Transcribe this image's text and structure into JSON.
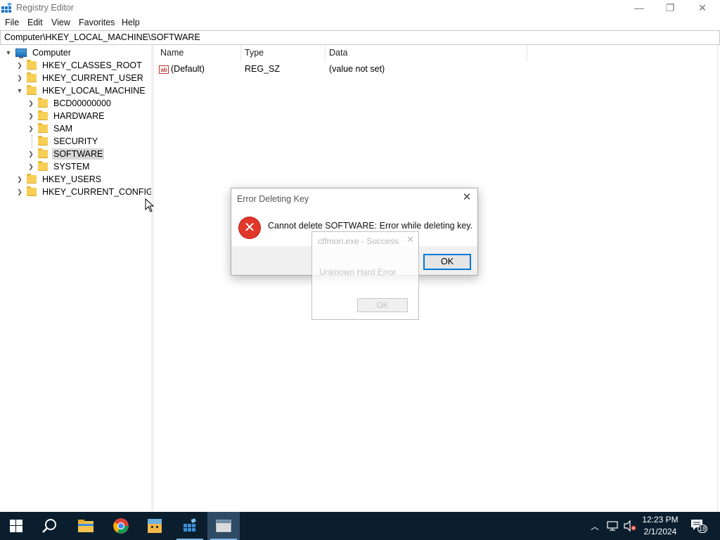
{
  "window": {
    "title": "Registry Editor",
    "minimize": "—",
    "restore": "❐",
    "close": "✕"
  },
  "menu": [
    "File",
    "Edit",
    "View",
    "Favorites",
    "Help"
  ],
  "address": "Computer\\HKEY_LOCAL_MACHINE\\SOFTWARE",
  "tree": {
    "root": "Computer",
    "hives": {
      "classes_root": "HKEY_CLASSES_ROOT",
      "current_user": "HKEY_CURRENT_USER",
      "local_machine": "HKEY_LOCAL_MACHINE",
      "users": "HKEY_USERS",
      "current_config": "HKEY_CURRENT_CONFIG"
    },
    "local_machine_children": [
      "BCD00000000",
      "HARDWARE",
      "SAM",
      "SECURITY",
      "SOFTWARE",
      "SYSTEM"
    ],
    "selected": "SOFTWARE"
  },
  "list": {
    "headers": {
      "name": "Name",
      "type": "Type",
      "data": "Data"
    },
    "rows": [
      {
        "name": "(Default)",
        "type": "REG_SZ",
        "data": "(value not set)",
        "icon": "ab"
      }
    ]
  },
  "error_dialog": {
    "title": "Error Deleting Key",
    "message": "Cannot delete SOFTWARE:  Error while deleting key.",
    "ok": "OK",
    "close": "✕",
    "icon": "✕"
  },
  "ghost_dialog": {
    "title": "ctfmon.exe - Success",
    "message": "Unknown Hard Error",
    "ok": "OK",
    "close": "✕"
  },
  "taskbar": {
    "time": "12:23 PM",
    "date": "2/1/2024",
    "notification_count": "18"
  },
  "colors": {
    "accent": "#0078d7",
    "taskbar": "#0a1e2d",
    "folder": "#f7cf55",
    "error": "#e2372b"
  }
}
